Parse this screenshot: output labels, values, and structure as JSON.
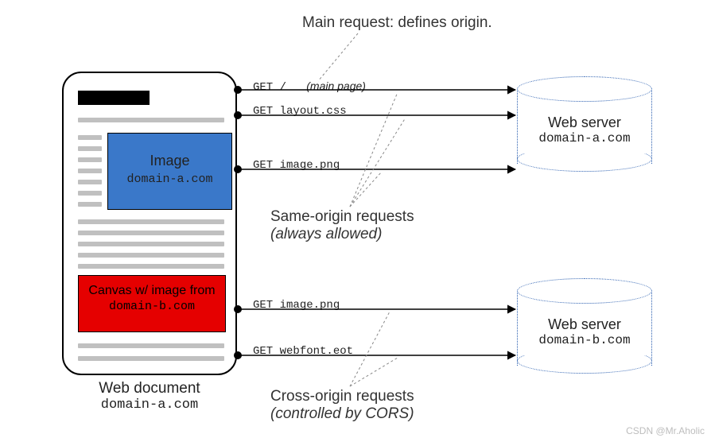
{
  "header_note": "Main request: defines origin.",
  "document": {
    "caption_title": "Web document",
    "caption_domain": "domain-a.com",
    "image_box": {
      "title": "Image",
      "domain": "domain-a.com"
    },
    "canvas_box": {
      "title": "Canvas w/ image from",
      "domain": "domain-b.com"
    }
  },
  "requests": {
    "r1": {
      "method": "GET",
      "path": "/",
      "hint": "(main page)"
    },
    "r2": {
      "method": "GET",
      "path": "layout.css"
    },
    "r3": {
      "method": "GET",
      "path": "image.png"
    },
    "r4": {
      "method": "GET",
      "path": "image.png"
    },
    "r5": {
      "method": "GET",
      "path": "webfont.eot"
    }
  },
  "groups": {
    "same": {
      "line1": "Same-origin requests",
      "line2": "(always allowed)"
    },
    "cross": {
      "line1": "Cross-origin requests",
      "line2": "(controlled by CORS)"
    }
  },
  "servers": {
    "a": {
      "title": "Web server",
      "domain": "domain-a.com"
    },
    "b": {
      "title": "Web server",
      "domain": "domain-b.com"
    }
  },
  "watermark": "CSDN @Mr.Aholic"
}
